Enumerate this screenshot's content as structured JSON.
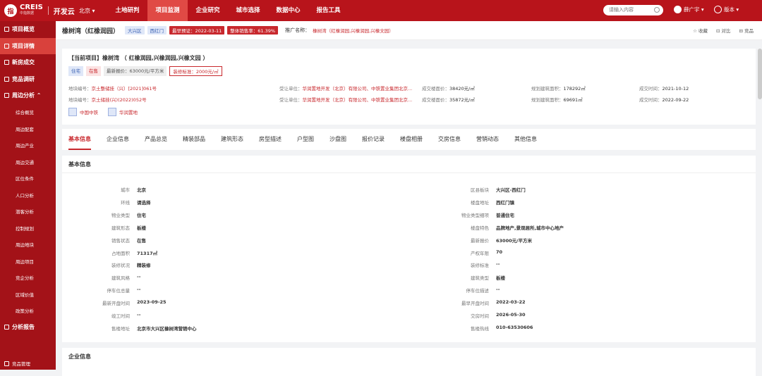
{
  "app": {
    "brand": "CREIS",
    "brand_sub": "中指数据",
    "app_name": "开发云",
    "city": "北京 ▾"
  },
  "nav": [
    "土地研判",
    "项目监测",
    "企业研究",
    "城市选择",
    "数据中心",
    "报告工具"
  ],
  "nav_active": 1,
  "search": {
    "placeholder": "请输入内容"
  },
  "user": {
    "name": "薛广宇 ▾"
  },
  "version": {
    "label": "版本 ▾"
  },
  "sidebar": {
    "items": [
      {
        "label": "项目概览"
      },
      {
        "label": "项目详情"
      },
      {
        "label": "新房成交"
      },
      {
        "label": "竞品调研"
      },
      {
        "label": "周边分析 ⌃"
      }
    ],
    "subitems": [
      "综合概览",
      "周边配套",
      "周边产业",
      "周边交通",
      "区位条件",
      "人口分析",
      "潜客分析",
      "控制规划",
      "周边地块",
      "周边项目",
      "竞企分析",
      "区域价值",
      "政策分析"
    ],
    "footer_item": "分析报告",
    "foot": "竞品管理"
  },
  "header": {
    "title": "橡树湾（红橡润园）",
    "tags": [
      "大兴区",
      "西红门"
    ],
    "first_cert": "最早预证：2022-03-11",
    "sell_rate": "整体销售率：61.39%",
    "promo_label": "推广名称：",
    "promo_value": "橡树湾（红橡润园,兴橡润园,兴橡文园）",
    "actions": [
      "☆ 收藏",
      "⊡ 对比",
      "⊟ 竞品"
    ]
  },
  "project": {
    "current": "【当前项目】橡树湾 （ 红橡润园,兴橡润园,兴橡文园 ）",
    "tags": [
      "住宅",
      "在售",
      "最新报价：63000元/平方米",
      "装修标准：2000元/㎡"
    ],
    "lands": [
      {
        "no_label": "地块编号：",
        "no": "京土整储挂（兴）[2021]061号",
        "bidder_label": "受让单位：",
        "bidder": "华润置地开发（北京）有限公司、中铁置业集团北京...",
        "price_label": "成交楼面价：",
        "price": "38420元/㎡",
        "area_label": "规划建筑面积：",
        "area": "178292㎡",
        "date_label": "成交时间：",
        "date": "2021-10-12"
      },
      {
        "no_label": "地块编号：",
        "no": "京土储挂(兴)(2022)052号",
        "bidder_label": "受让单位：",
        "bidder": "华润置地开发（北京）有限公司、中铁置业集团北京...",
        "price_label": "成交楼面价：",
        "price": "35872元/㎡",
        "area_label": "规划建筑面积：",
        "area": "69691㎡",
        "date_label": "成交时间：",
        "date": "2022-09-22"
      }
    ],
    "developers": [
      "中国中铁",
      "华润置地"
    ]
  },
  "tabs": [
    "基本信息",
    "企业信息",
    "产品总览",
    "精装部品",
    "建筑形态",
    "房型描述",
    "户型图",
    "沙盘图",
    "报价记录",
    "楼盘相册",
    "交房信息",
    "营销动态",
    "其他信息"
  ],
  "basic": {
    "title": "基本信息",
    "left": [
      [
        "城市",
        "北京"
      ],
      [
        "环线",
        "请选择"
      ],
      [
        "物业类型",
        "住宅"
      ],
      [
        "建筑形态",
        "板楼"
      ],
      [
        "销售状态",
        "在售"
      ],
      [
        "占地面积",
        "71317㎡"
      ],
      [
        "装修状况",
        "精装修"
      ],
      [
        "建筑风格",
        "--"
      ],
      [
        "停车位总量",
        "--"
      ],
      [
        "最新开盘时间",
        "2023-09-25"
      ],
      [
        "竣工时间",
        "--"
      ],
      [
        "售楼地址",
        "北京市大兴区橡树湾营销中心"
      ]
    ],
    "right": [
      [
        "区县板块",
        "大兴区-西红门"
      ],
      [
        "楼盘地址",
        "西红门镇"
      ],
      [
        "物业类型细项",
        "普通住宅"
      ],
      [
        "楼盘特色",
        "品牌地产,景观居所,城市中心地产"
      ],
      [
        "最新报价",
        "63000元/平方米"
      ],
      [
        "产权年限",
        "70"
      ],
      [
        "装修标准",
        "--"
      ],
      [
        "建筑类型",
        "板楼"
      ],
      [
        "停车位描述",
        "--"
      ],
      [
        "最早开盘时间",
        "2022-03-22"
      ],
      [
        "交房时间",
        "2026-05-30"
      ],
      [
        "售楼热线",
        "010-63530606"
      ]
    ]
  },
  "company": {
    "title": "企业信息"
  }
}
